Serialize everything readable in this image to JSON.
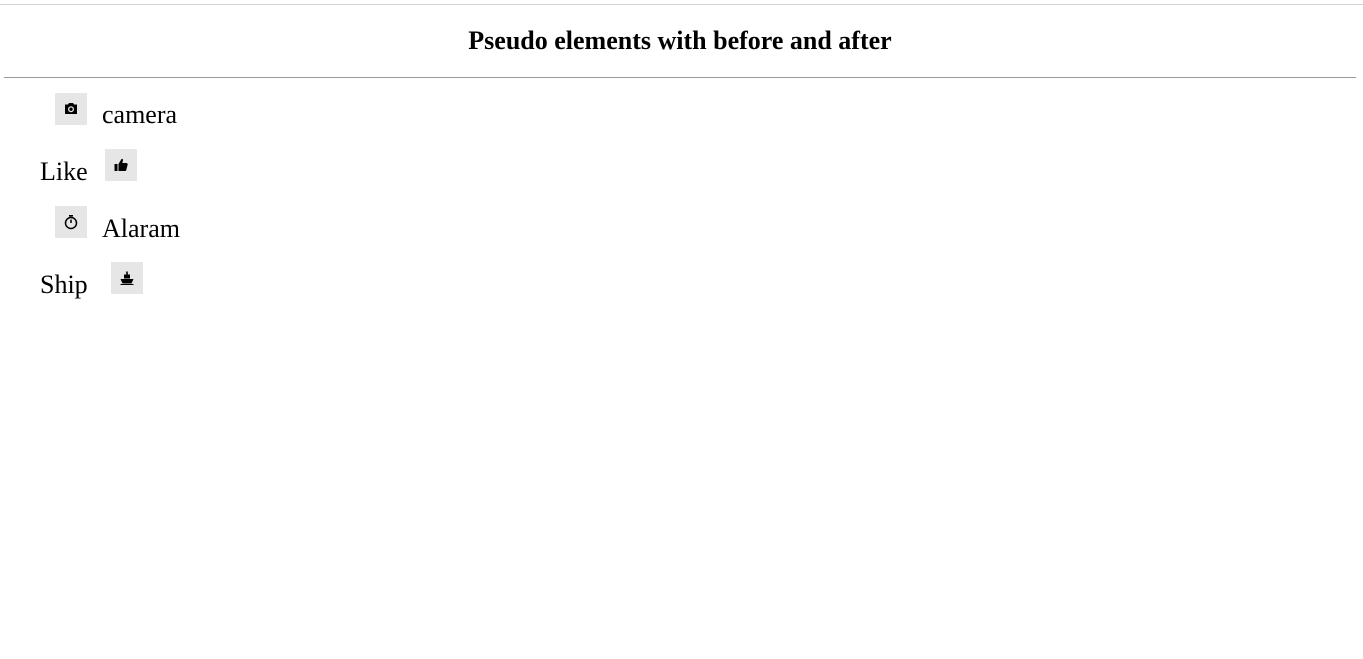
{
  "page": {
    "title": "Pseudo elements with before and after"
  },
  "items": [
    {
      "label": "camera",
      "icon": "camera-icon",
      "icon_position": "before"
    },
    {
      "label": "Like",
      "icon": "thumbs-up-icon",
      "icon_position": "after"
    },
    {
      "label": "Alaram",
      "icon": "stopwatch-icon",
      "icon_position": "before"
    },
    {
      "label": "Ship",
      "icon": "ship-icon",
      "icon_position": "after"
    }
  ],
  "colors": {
    "icon_background": "#e6e6e6",
    "text": "#000000",
    "divider": "#9a9a9a"
  }
}
